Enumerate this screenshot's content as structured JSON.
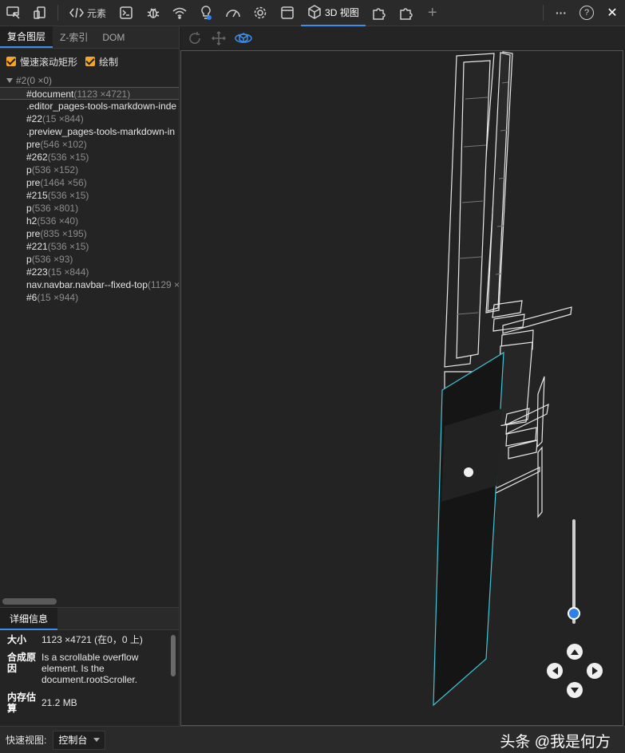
{
  "toolbar": {
    "elements_label": "元素",
    "view3d_label": "3D 视图",
    "new_tab_glyph": "+",
    "more_glyph": "···",
    "help_glyph": "?",
    "close_glyph": "✕"
  },
  "left_tabs": [
    "复合图层",
    "Z-索引",
    "DOM"
  ],
  "checkboxes": [
    {
      "label": "慢速滚动矩形",
      "checked": true
    },
    {
      "label": "绘制",
      "checked": true
    }
  ],
  "tree": {
    "root": "#2(0 ×0)",
    "items": [
      {
        "name": "#document",
        "size": "(1123 ×4721)"
      },
      {
        "name": ".editor_pages-tools-markdown-inde",
        "size": ""
      },
      {
        "name": "#22",
        "size": "(15 ×844)"
      },
      {
        "name": ".preview_pages-tools-markdown-in",
        "size": ""
      },
      {
        "name": "pre",
        "size": "(546 ×102)"
      },
      {
        "name": "#262",
        "size": "(536 ×15)"
      },
      {
        "name": "p",
        "size": "(536 ×152)"
      },
      {
        "name": "pre",
        "size": "(1464 ×56)"
      },
      {
        "name": "#215",
        "size": "(536 ×15)"
      },
      {
        "name": "p",
        "size": "(536 ×801)"
      },
      {
        "name": "h2",
        "size": "(536 ×40)"
      },
      {
        "name": "pre",
        "size": "(835 ×195)"
      },
      {
        "name": "#221",
        "size": "(536 ×15)"
      },
      {
        "name": "p",
        "size": "(536 ×93)"
      },
      {
        "name": "#223",
        "size": "(15 ×844)"
      },
      {
        "name": "nav.navbar.navbar--fixed-top",
        "size": "(1129 ×"
      },
      {
        "name": "#6",
        "size": "(15 ×944)"
      }
    ]
  },
  "details": {
    "tab_label": "详细信息",
    "rows": [
      {
        "key": "大小",
        "value": "1123 ×4721 (在0，0 上)"
      },
      {
        "key": "合成原因",
        "value": "Is a scrollable overflow element. Is the document.rootScroller."
      },
      {
        "key": "内存估算",
        "value": "21.2 MB"
      }
    ]
  },
  "bottom": {
    "quick_view_label": "快速视图:",
    "quick_view_value": "控制台"
  },
  "watermark": "头条 @我是何方",
  "zoom_slider": {
    "level": 0.1
  },
  "colors": {
    "accent": "#3b8eea",
    "checkbox": "#f5a623",
    "slider_thumb": "#2f80ed",
    "layer_highlight": "#3ec6d8"
  }
}
